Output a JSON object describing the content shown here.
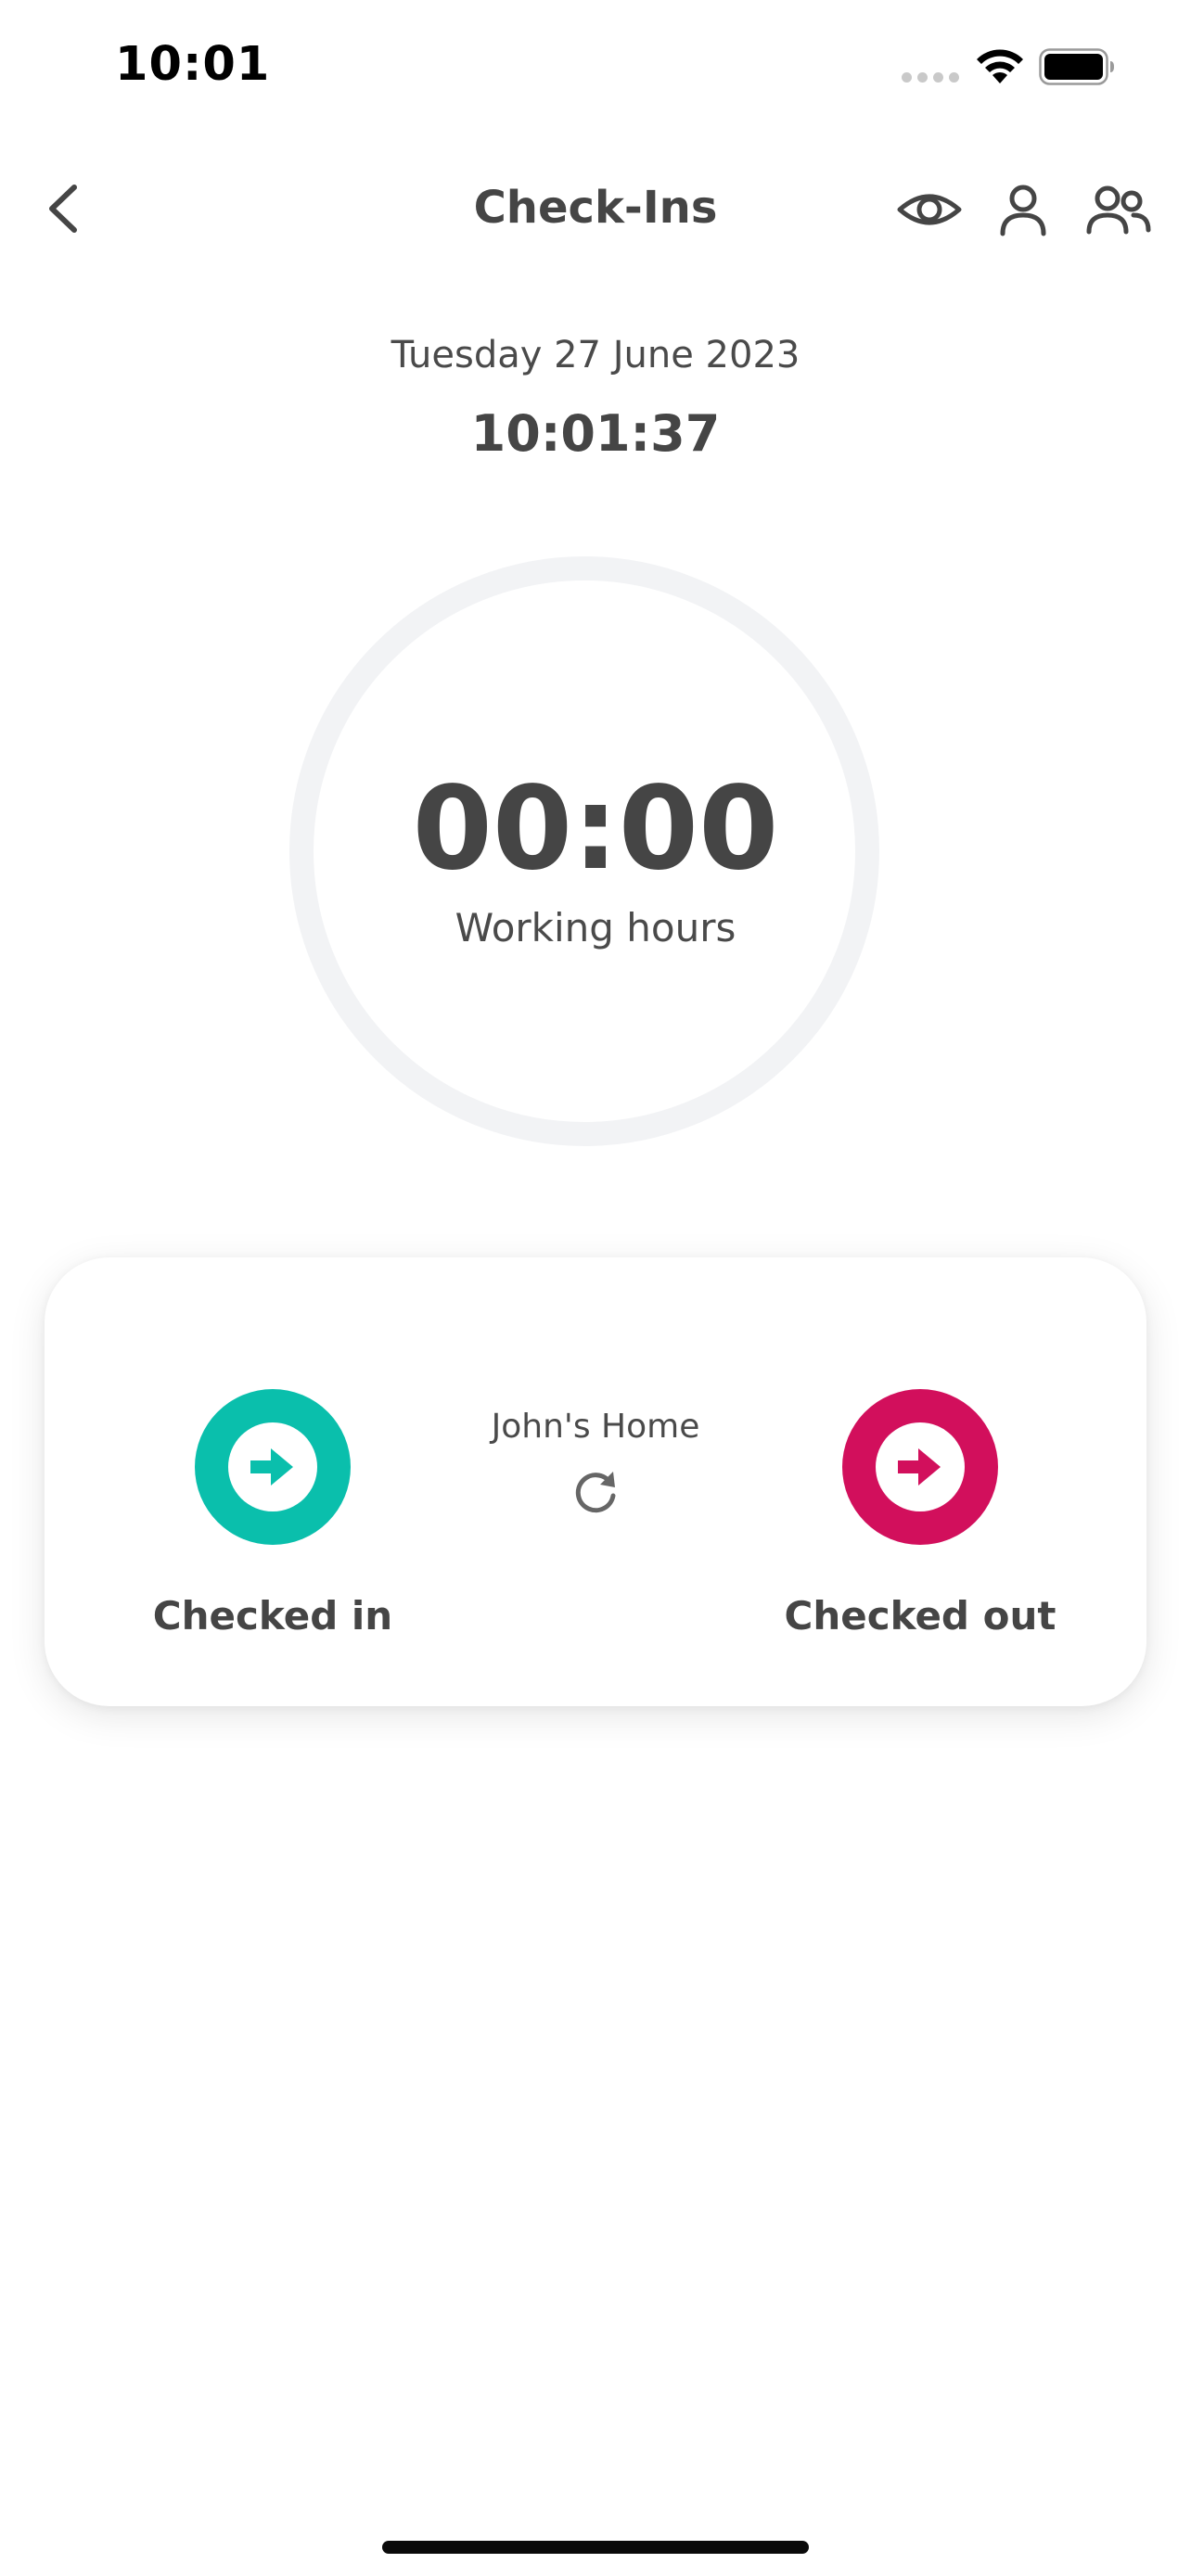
{
  "status_bar": {
    "time": "10:01",
    "wifi_icon": "wifi-icon",
    "battery_icon": "battery-full-icon"
  },
  "header": {
    "title": "Check-Ins",
    "back_icon": "chevron-left-icon",
    "actions": [
      "eye-icon",
      "user-icon",
      "users-icon"
    ]
  },
  "date": "Tuesday 27 June 2023",
  "clock": "10:01:37",
  "working": {
    "value": "00:00",
    "label": "Working hours"
  },
  "card": {
    "location": "John's Home",
    "refresh_icon": "refresh-icon",
    "check_in": {
      "label": "Checked in",
      "color": "#0abfac",
      "icon": "arrow-right-icon"
    },
    "check_out": {
      "label": "Checked out",
      "color": "#d20f5c",
      "icon": "arrow-right-icon"
    }
  },
  "colors": {
    "text_primary": "#454545",
    "ring_track": "#f2f3f5",
    "check_in": "#0abfac",
    "check_out": "#d20f5c"
  }
}
